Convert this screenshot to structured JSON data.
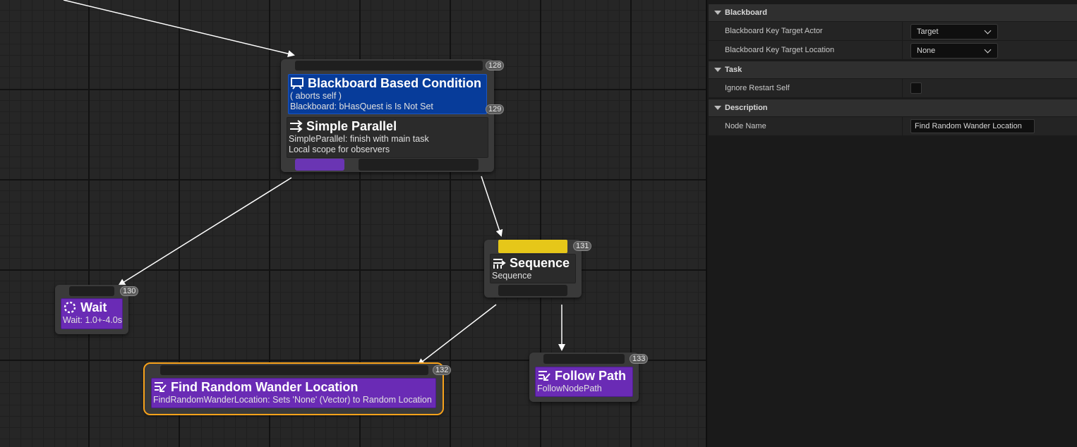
{
  "graph": {
    "nodes": {
      "selector": {
        "index": "128",
        "decorator": {
          "title": "Blackboard Based Condition",
          "line1": "( aborts self )",
          "line2": "Blackboard: bHasQuest is Is Not Set",
          "index": "129"
        },
        "composite": {
          "title": "Simple Parallel",
          "line1": "SimpleParallel: finish with main task",
          "line2": "Local scope for observers"
        }
      },
      "sequence": {
        "index": "131",
        "title": "Sequence",
        "subtitle": "Sequence",
        "highlight_color": "#e6c719"
      },
      "wait": {
        "index": "130",
        "title": "Wait",
        "subtitle": "Wait: 1.0+-4.0s"
      },
      "find_random": {
        "index": "132",
        "title": "Find Random Wander Location",
        "subtitle": "FindRandomWanderLocation: Sets 'None' (Vector) to Random Location",
        "selection_color": "#f7a21b"
      },
      "follow_path": {
        "index": "133",
        "title": "Follow Path",
        "subtitle": "FollowNodePath"
      }
    },
    "colors": {
      "decorator_blue": "#073c9a",
      "task_purple": "#6a2bb5",
      "parallel_pin_purple": "#6a35b3"
    }
  },
  "details": {
    "sections": {
      "blackboard": {
        "header": "Blackboard",
        "rows": [
          {
            "label": "Blackboard Key Target Actor",
            "value": "Target"
          },
          {
            "label": "Blackboard Key Target Location",
            "value": "None"
          }
        ]
      },
      "task": {
        "header": "Task",
        "rows": [
          {
            "label": "Ignore Restart Self",
            "checked": false
          }
        ]
      },
      "description": {
        "header": "Description",
        "rows": [
          {
            "label": "Node Name",
            "value": "Find Random Wander Location"
          }
        ]
      }
    }
  }
}
